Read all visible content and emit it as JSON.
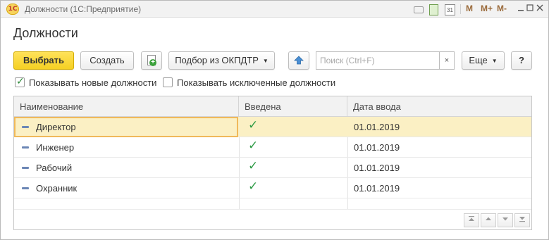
{
  "window": {
    "logo_text": "1С",
    "title": "Должности  (1С:Предприятие)",
    "buttons": {
      "m": "M",
      "m_plus": "M+",
      "m_minus": "M-",
      "minimize": "—",
      "maximize": "☐",
      "close": "✕"
    }
  },
  "page": {
    "title": "Должности"
  },
  "toolbar": {
    "select_label": "Выбрать",
    "create_label": "Создать",
    "okpdtr_label": "Подбор из ОКПДТР",
    "search_placeholder": "Поиск (Ctrl+F)",
    "search_clear": "×",
    "more_label": "Еще",
    "help_label": "?"
  },
  "filters": {
    "show_new": {
      "label": "Показывать новые должности",
      "checked": true
    },
    "show_excluded": {
      "label": "Показывать исключенные должности",
      "checked": false
    }
  },
  "table": {
    "columns": [
      "Наименование",
      "Введена",
      "Дата ввода"
    ],
    "rows": [
      {
        "name": "Директор",
        "introduced": true,
        "date": "01.01.2019",
        "selected": true
      },
      {
        "name": "Инженер",
        "introduced": true,
        "date": "01.01.2019",
        "selected": false
      },
      {
        "name": "Рабочий",
        "introduced": true,
        "date": "01.01.2019",
        "selected": false
      },
      {
        "name": "Охранник",
        "introduced": true,
        "date": "01.01.2019",
        "selected": false
      }
    ],
    "check_glyph": "✓"
  },
  "colors": {
    "accent_yellow": "#f5d023",
    "selected_row": "#fbf0c4",
    "check_green": "#2e9b45"
  },
  "icons": [
    "app-logo-icon",
    "link-icon",
    "calculator-icon",
    "calendar-icon",
    "create-document-icon",
    "up-arrow-icon",
    "clear-icon",
    "row-dash-icon",
    "nav-first-icon",
    "nav-up-icon",
    "nav-down-icon",
    "nav-last-icon"
  ]
}
